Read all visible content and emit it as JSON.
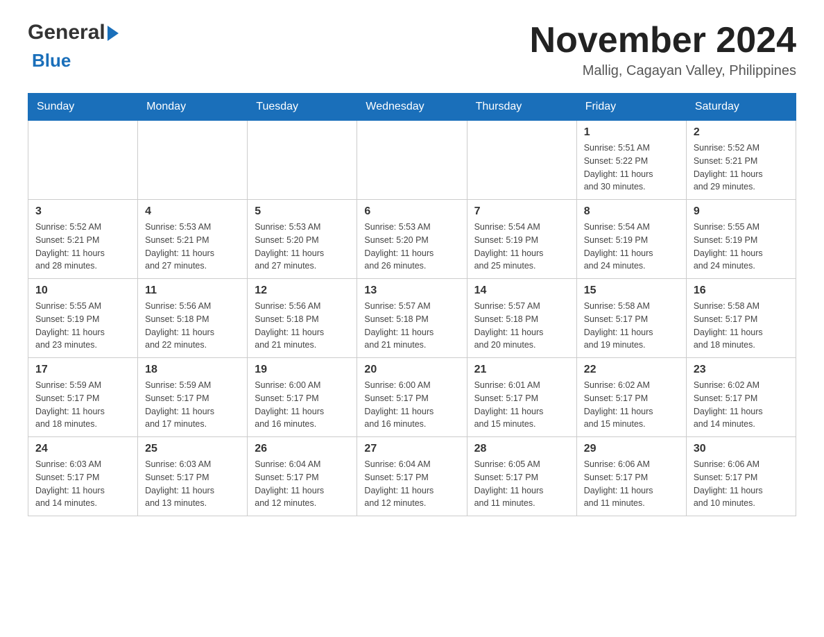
{
  "header": {
    "logo_general": "General",
    "logo_blue": "Blue",
    "month_title": "November 2024",
    "location": "Mallig, Cagayan Valley, Philippines"
  },
  "days_of_week": [
    "Sunday",
    "Monday",
    "Tuesday",
    "Wednesday",
    "Thursday",
    "Friday",
    "Saturday"
  ],
  "weeks": [
    {
      "days": [
        {
          "number": "",
          "info": ""
        },
        {
          "number": "",
          "info": ""
        },
        {
          "number": "",
          "info": ""
        },
        {
          "number": "",
          "info": ""
        },
        {
          "number": "",
          "info": ""
        },
        {
          "number": "1",
          "info": "Sunrise: 5:51 AM\nSunset: 5:22 PM\nDaylight: 11 hours\nand 30 minutes."
        },
        {
          "number": "2",
          "info": "Sunrise: 5:52 AM\nSunset: 5:21 PM\nDaylight: 11 hours\nand 29 minutes."
        }
      ]
    },
    {
      "days": [
        {
          "number": "3",
          "info": "Sunrise: 5:52 AM\nSunset: 5:21 PM\nDaylight: 11 hours\nand 28 minutes."
        },
        {
          "number": "4",
          "info": "Sunrise: 5:53 AM\nSunset: 5:21 PM\nDaylight: 11 hours\nand 27 minutes."
        },
        {
          "number": "5",
          "info": "Sunrise: 5:53 AM\nSunset: 5:20 PM\nDaylight: 11 hours\nand 27 minutes."
        },
        {
          "number": "6",
          "info": "Sunrise: 5:53 AM\nSunset: 5:20 PM\nDaylight: 11 hours\nand 26 minutes."
        },
        {
          "number": "7",
          "info": "Sunrise: 5:54 AM\nSunset: 5:19 PM\nDaylight: 11 hours\nand 25 minutes."
        },
        {
          "number": "8",
          "info": "Sunrise: 5:54 AM\nSunset: 5:19 PM\nDaylight: 11 hours\nand 24 minutes."
        },
        {
          "number": "9",
          "info": "Sunrise: 5:55 AM\nSunset: 5:19 PM\nDaylight: 11 hours\nand 24 minutes."
        }
      ]
    },
    {
      "days": [
        {
          "number": "10",
          "info": "Sunrise: 5:55 AM\nSunset: 5:19 PM\nDaylight: 11 hours\nand 23 minutes."
        },
        {
          "number": "11",
          "info": "Sunrise: 5:56 AM\nSunset: 5:18 PM\nDaylight: 11 hours\nand 22 minutes."
        },
        {
          "number": "12",
          "info": "Sunrise: 5:56 AM\nSunset: 5:18 PM\nDaylight: 11 hours\nand 21 minutes."
        },
        {
          "number": "13",
          "info": "Sunrise: 5:57 AM\nSunset: 5:18 PM\nDaylight: 11 hours\nand 21 minutes."
        },
        {
          "number": "14",
          "info": "Sunrise: 5:57 AM\nSunset: 5:18 PM\nDaylight: 11 hours\nand 20 minutes."
        },
        {
          "number": "15",
          "info": "Sunrise: 5:58 AM\nSunset: 5:17 PM\nDaylight: 11 hours\nand 19 minutes."
        },
        {
          "number": "16",
          "info": "Sunrise: 5:58 AM\nSunset: 5:17 PM\nDaylight: 11 hours\nand 18 minutes."
        }
      ]
    },
    {
      "days": [
        {
          "number": "17",
          "info": "Sunrise: 5:59 AM\nSunset: 5:17 PM\nDaylight: 11 hours\nand 18 minutes."
        },
        {
          "number": "18",
          "info": "Sunrise: 5:59 AM\nSunset: 5:17 PM\nDaylight: 11 hours\nand 17 minutes."
        },
        {
          "number": "19",
          "info": "Sunrise: 6:00 AM\nSunset: 5:17 PM\nDaylight: 11 hours\nand 16 minutes."
        },
        {
          "number": "20",
          "info": "Sunrise: 6:00 AM\nSunset: 5:17 PM\nDaylight: 11 hours\nand 16 minutes."
        },
        {
          "number": "21",
          "info": "Sunrise: 6:01 AM\nSunset: 5:17 PM\nDaylight: 11 hours\nand 15 minutes."
        },
        {
          "number": "22",
          "info": "Sunrise: 6:02 AM\nSunset: 5:17 PM\nDaylight: 11 hours\nand 15 minutes."
        },
        {
          "number": "23",
          "info": "Sunrise: 6:02 AM\nSunset: 5:17 PM\nDaylight: 11 hours\nand 14 minutes."
        }
      ]
    },
    {
      "days": [
        {
          "number": "24",
          "info": "Sunrise: 6:03 AM\nSunset: 5:17 PM\nDaylight: 11 hours\nand 14 minutes."
        },
        {
          "number": "25",
          "info": "Sunrise: 6:03 AM\nSunset: 5:17 PM\nDaylight: 11 hours\nand 13 minutes."
        },
        {
          "number": "26",
          "info": "Sunrise: 6:04 AM\nSunset: 5:17 PM\nDaylight: 11 hours\nand 12 minutes."
        },
        {
          "number": "27",
          "info": "Sunrise: 6:04 AM\nSunset: 5:17 PM\nDaylight: 11 hours\nand 12 minutes."
        },
        {
          "number": "28",
          "info": "Sunrise: 6:05 AM\nSunset: 5:17 PM\nDaylight: 11 hours\nand 11 minutes."
        },
        {
          "number": "29",
          "info": "Sunrise: 6:06 AM\nSunset: 5:17 PM\nDaylight: 11 hours\nand 11 minutes."
        },
        {
          "number": "30",
          "info": "Sunrise: 6:06 AM\nSunset: 5:17 PM\nDaylight: 11 hours\nand 10 minutes."
        }
      ]
    }
  ]
}
